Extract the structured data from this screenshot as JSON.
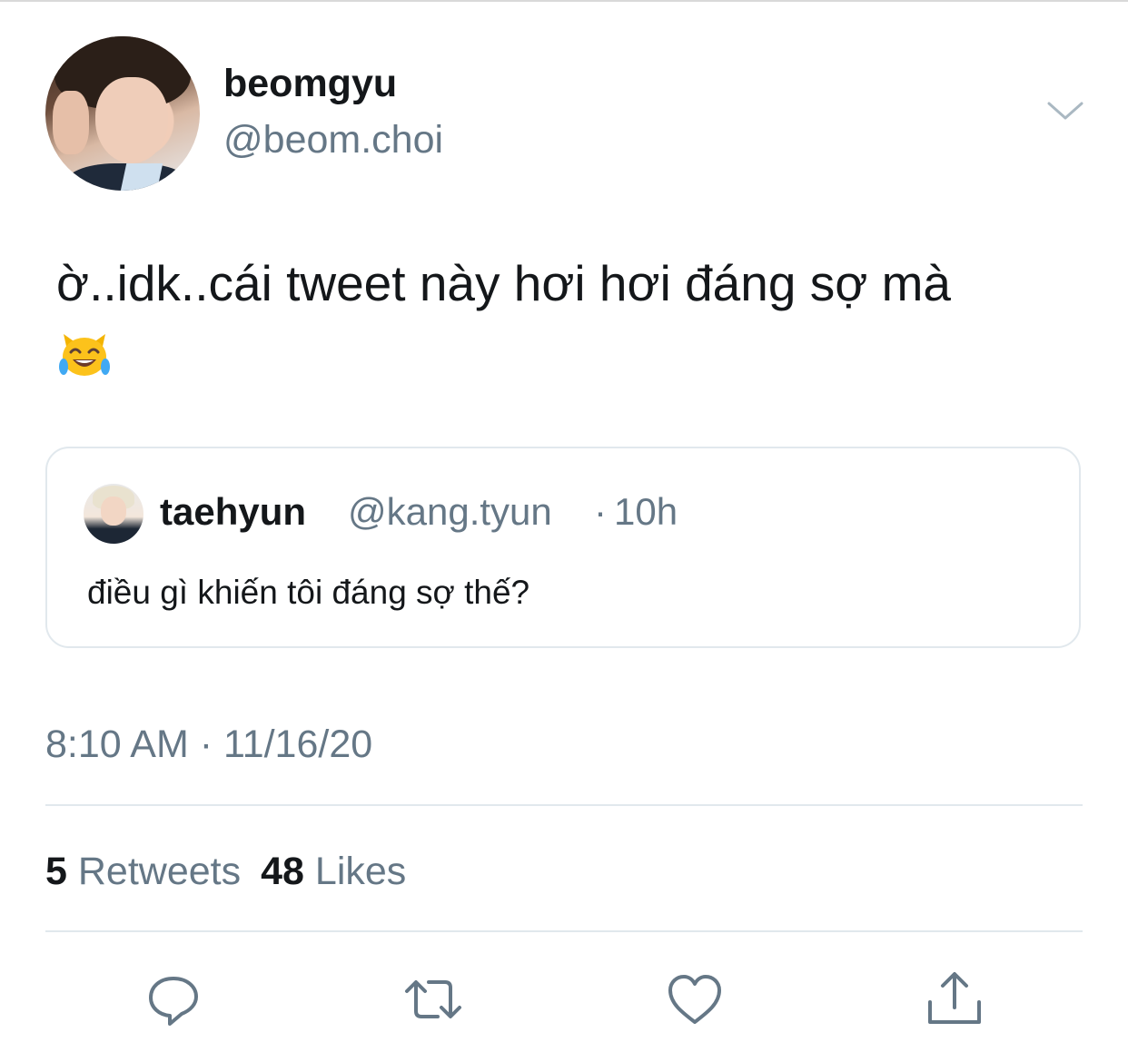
{
  "tweet": {
    "author": {
      "display_name": "beomgyu",
      "handle": "@beom.choi"
    },
    "text": "ờ..idk..cái tweet này hơi hơi đáng sợ mà",
    "emoji": "cat-face-with-tears-of-joy",
    "timestamp": "8:10 AM · 11/16/20",
    "stats": {
      "retweets_count": "5",
      "retweets_label": "Retweets",
      "likes_count": "48",
      "likes_label": "Likes"
    }
  },
  "quoted_tweet": {
    "display_name": "taehyun",
    "handle": "@kang.tyun",
    "separator": "·",
    "time": "10h",
    "text": "điều gì khiến tôi đáng sợ thế?"
  },
  "actions": [
    {
      "icon": "reply-icon"
    },
    {
      "icon": "retweet-icon"
    },
    {
      "icon": "like-icon"
    },
    {
      "icon": "share-icon"
    }
  ],
  "colors": {
    "primary_text": "#14171a",
    "secondary_text": "#657786",
    "border": "#e1e8ed"
  }
}
